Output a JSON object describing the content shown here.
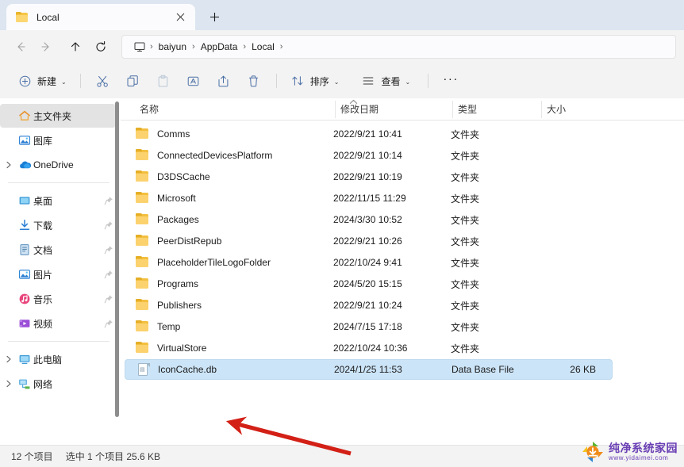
{
  "window": {
    "tab": {
      "title": "Local",
      "folder_icon": "folder-icon",
      "close_icon": "close-icon"
    },
    "new_tab_label": "+"
  },
  "nav": {
    "back": "back-arrow-icon",
    "forward": "forward-arrow-icon",
    "up": "up-arrow-icon",
    "refresh": "refresh-icon"
  },
  "address": {
    "pc_icon": "this-pc-icon",
    "separator": "›",
    "crumbs": [
      "baiyun",
      "AppData",
      "Local"
    ]
  },
  "toolbar": {
    "new_label": "新建",
    "cut_label": "剪切",
    "copy_label": "复制",
    "paste_label": "粘贴",
    "rename_label": "重命名",
    "share_label": "共享",
    "delete_label": "删除",
    "sort_label": "排序",
    "view_label": "查看",
    "more_label": "···",
    "chevron": "⌄"
  },
  "sidebar": {
    "items": [
      {
        "label": "主文件夹",
        "icon": "home-icon",
        "selected": true,
        "expandable": false,
        "pinned": false
      },
      {
        "label": "图库",
        "icon": "gallery-icon",
        "selected": false,
        "expandable": false,
        "pinned": false
      },
      {
        "label": "OneDrive",
        "icon": "onedrive-cloud-icon",
        "selected": false,
        "expandable": true,
        "pinned": false
      }
    ],
    "pinned": [
      {
        "label": "桌面",
        "icon": "desktop-icon",
        "pinned": true
      },
      {
        "label": "下载",
        "icon": "downloads-icon",
        "pinned": true
      },
      {
        "label": "文档",
        "icon": "documents-icon",
        "pinned": true
      },
      {
        "label": "图片",
        "icon": "pictures-icon",
        "pinned": true
      },
      {
        "label": "音乐",
        "icon": "music-icon",
        "pinned": true
      },
      {
        "label": "视频",
        "icon": "videos-icon",
        "pinned": true
      }
    ],
    "devices": [
      {
        "label": "此电脑",
        "icon": "this-pc-icon",
        "expandable": true
      },
      {
        "label": "网络",
        "icon": "network-icon",
        "expandable": true
      }
    ]
  },
  "columns": {
    "name": "名称",
    "date": "修改日期",
    "type": "类型",
    "size": "大小",
    "sort_arrow": "⌃"
  },
  "files": [
    {
      "name": "Comms",
      "date": "2022/9/21 10:41",
      "type": "文件夹",
      "size": "",
      "icon": "folder-icon",
      "selected": false
    },
    {
      "name": "ConnectedDevicesPlatform",
      "date": "2022/9/21 10:14",
      "type": "文件夹",
      "size": "",
      "icon": "folder-icon",
      "selected": false
    },
    {
      "name": "D3DSCache",
      "date": "2022/9/21 10:19",
      "type": "文件夹",
      "size": "",
      "icon": "folder-icon",
      "selected": false
    },
    {
      "name": "Microsoft",
      "date": "2022/11/15 11:29",
      "type": "文件夹",
      "size": "",
      "icon": "folder-icon",
      "selected": false
    },
    {
      "name": "Packages",
      "date": "2024/3/30 10:52",
      "type": "文件夹",
      "size": "",
      "icon": "folder-icon",
      "selected": false
    },
    {
      "name": "PeerDistRepub",
      "date": "2022/9/21 10:26",
      "type": "文件夹",
      "size": "",
      "icon": "folder-icon",
      "selected": false
    },
    {
      "name": "PlaceholderTileLogoFolder",
      "date": "2022/10/24 9:41",
      "type": "文件夹",
      "size": "",
      "icon": "folder-icon",
      "selected": false
    },
    {
      "name": "Programs",
      "date": "2024/5/20 15:15",
      "type": "文件夹",
      "size": "",
      "icon": "folder-icon",
      "selected": false
    },
    {
      "name": "Publishers",
      "date": "2022/9/21 10:24",
      "type": "文件夹",
      "size": "",
      "icon": "folder-icon",
      "selected": false
    },
    {
      "name": "Temp",
      "date": "2024/7/15 17:18",
      "type": "文件夹",
      "size": "",
      "icon": "folder-icon",
      "selected": false
    },
    {
      "name": "VirtualStore",
      "date": "2022/10/24 10:36",
      "type": "文件夹",
      "size": "",
      "icon": "folder-icon",
      "selected": false
    },
    {
      "name": "IconCache.db",
      "date": "2024/1/25 11:53",
      "type": "Data Base File",
      "size": "26 KB",
      "icon": "database-file-icon",
      "selected": true
    }
  ],
  "status": {
    "item_count": "12 个项目",
    "selection": "选中 1 个项目  25.6 KB"
  },
  "annotation": {
    "arrow_color": "#d32016"
  },
  "watermark": {
    "title": "纯净系统家园",
    "url": "www.yidaimei.com",
    "colors": {
      "green": "#5cb531",
      "orange": "#f08c1a",
      "blue": "#2f86d6",
      "purple": "#6a3fb5"
    }
  }
}
